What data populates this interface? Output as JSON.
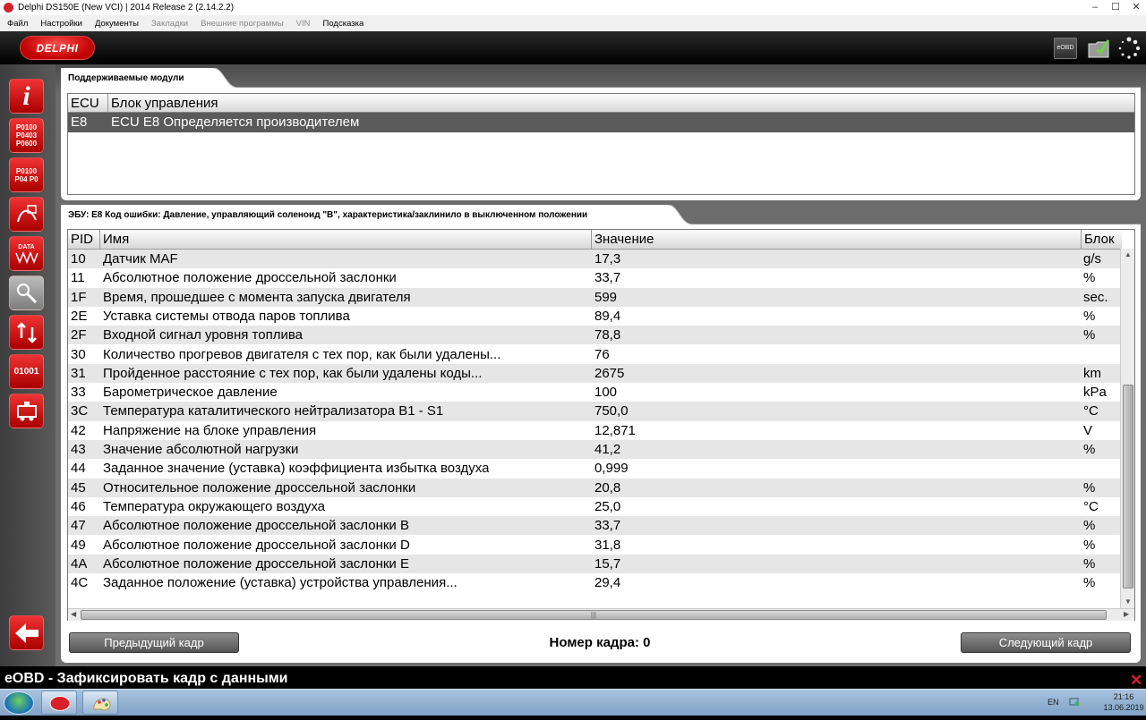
{
  "window": {
    "title": "Delphi DS150E (New VCI) | 2014 Release 2 (2.14.2.2)"
  },
  "menu": [
    {
      "label": "Файл",
      "enabled": true
    },
    {
      "label": "Настройки",
      "enabled": true
    },
    {
      "label": "Документы",
      "enabled": true
    },
    {
      "label": "Закладки",
      "enabled": false
    },
    {
      "label": "Внешние программы",
      "enabled": false
    },
    {
      "label": "VIN",
      "enabled": false
    },
    {
      "label": "Подсказка",
      "enabled": true
    }
  ],
  "header": {
    "logo_text": "DELPHI",
    "eobd_label": "eOBD"
  },
  "sidebar": {
    "buttons": [
      {
        "icon": "info-icon",
        "label": "i"
      },
      {
        "icon": "dtc-codes-icon",
        "label": "P0100 P0403 P0600"
      },
      {
        "icon": "clear-codes-icon",
        "label": "P0100 P04 P0"
      },
      {
        "icon": "freeze-frame-icon",
        "label": ""
      },
      {
        "icon": "live-data-icon",
        "label": "DATA"
      },
      {
        "icon": "oxygen-sensor-icon",
        "label": ""
      },
      {
        "icon": "component-test-icon",
        "label": ""
      },
      {
        "icon": "onboard-monitoring-icon",
        "label": "01001"
      },
      {
        "icon": "vehicle-info-icon",
        "label": ""
      }
    ],
    "back_icon": "back-arrow-icon"
  },
  "modules": {
    "tab_title": "Поддерживаемые модули",
    "columns": [
      "ECU",
      "Блок управления"
    ],
    "rows": [
      {
        "ecu": "E8",
        "name": "ECU E8 Определяется производителем"
      }
    ]
  },
  "freeze": {
    "tab_title": "ЭБУ: E8 Код ошибки: Давление, управляющий соленоид \"B\", характеристика/заклинило в выключенном положении",
    "columns": [
      "PID",
      "Имя",
      "Значение",
      "Блок"
    ],
    "rows": [
      {
        "pid": "10",
        "name": "Датчик MAF",
        "value": "17,3",
        "unit": "g/s"
      },
      {
        "pid": "11",
        "name": "Абсолютное положение дроссельной заслонки",
        "value": "33,7",
        "unit": "%"
      },
      {
        "pid": "1F",
        "name": "Время, прошедшее с момента запуска двигателя",
        "value": "599",
        "unit": "sec."
      },
      {
        "pid": "2E",
        "name": "Уставка системы отвода паров топлива",
        "value": "89,4",
        "unit": "%"
      },
      {
        "pid": "2F",
        "name": "Входной сигнал уровня топлива",
        "value": "78,8",
        "unit": "%"
      },
      {
        "pid": "30",
        "name": "Количество прогревов двигателя с тех пор, как были удалены...",
        "value": "76",
        "unit": ""
      },
      {
        "pid": "31",
        "name": "Пройденное расстояние с тех пор, как были удалены коды...",
        "value": "2675",
        "unit": "km"
      },
      {
        "pid": "33",
        "name": "Барометрическое давление",
        "value": "100",
        "unit": "kPa"
      },
      {
        "pid": "3C",
        "name": "Температура каталитического нейтрализатора B1 - S1",
        "value": "750,0",
        "unit": "°C"
      },
      {
        "pid": "42",
        "name": "Напряжение на блоке управления",
        "value": "12,871",
        "unit": "V"
      },
      {
        "pid": "43",
        "name": "Значение абсолютной нагрузки",
        "value": "41,2",
        "unit": "%"
      },
      {
        "pid": "44",
        "name": "Заданное значение (уставка) коэффициента избытка воздуха",
        "value": "0,999",
        "unit": ""
      },
      {
        "pid": "45",
        "name": "Относительное положение дроссельной заслонки",
        "value": "20,8",
        "unit": "%"
      },
      {
        "pid": "46",
        "name": "Температура окружающего воздуха",
        "value": "25,0",
        "unit": "°C"
      },
      {
        "pid": "47",
        "name": "Абсолютное положение дроссельной заслонки B",
        "value": "33,7",
        "unit": "%"
      },
      {
        "pid": "49",
        "name": "Абсолютное положение дроссельной заслонки D",
        "value": "31,8",
        "unit": "%"
      },
      {
        "pid": "4A",
        "name": "Абсолютное положение дроссельной заслонки E",
        "value": "15,7",
        "unit": "%"
      },
      {
        "pid": "4C",
        "name": "Заданное положение (уставка) устройства управления...",
        "value": "29,4",
        "unit": "%"
      }
    ],
    "prev_label": "Предыдущий кадр",
    "next_label": "Следующий кадр",
    "frame_label": "Номер кадра: 0"
  },
  "status": {
    "text": "eOBD - Зафиксировать кадр с данными"
  },
  "taskbar": {
    "language": "EN",
    "time": "21:16",
    "date": "13.06.2019",
    "apps": [
      "delphi-app-icon",
      "paint-app-icon"
    ]
  },
  "colors": {
    "brand_red": "#d8202a",
    "selected_row": "#5a5a5a",
    "alt_row": "#e6e6e6"
  }
}
